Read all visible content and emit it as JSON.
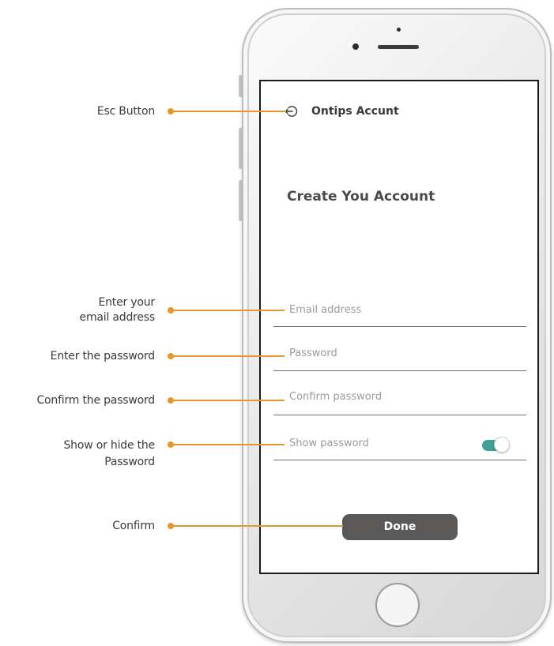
{
  "annotations": {
    "esc": "Esc Button",
    "email_line1": "Enter your",
    "email_line2": "email address",
    "password": "Enter the password",
    "confirm_password": "Confirm the password",
    "show_line1": "Show or hide the",
    "show_line2": "Password",
    "confirm": "Confirm"
  },
  "screen": {
    "app_title": "Ontips Accunt",
    "heading": "Create You Account",
    "email_placeholder": "Email address",
    "password_placeholder": "Password",
    "confirm_placeholder": "Confirm password",
    "show_password_label": "Show password",
    "show_password_on": true,
    "done_label": "Done"
  },
  "icons": {
    "esc": "back-arrow-icon"
  },
  "colors": {
    "annotation": "#e8952b",
    "toggle_on": "#3fa196",
    "button": "#5a5958"
  }
}
